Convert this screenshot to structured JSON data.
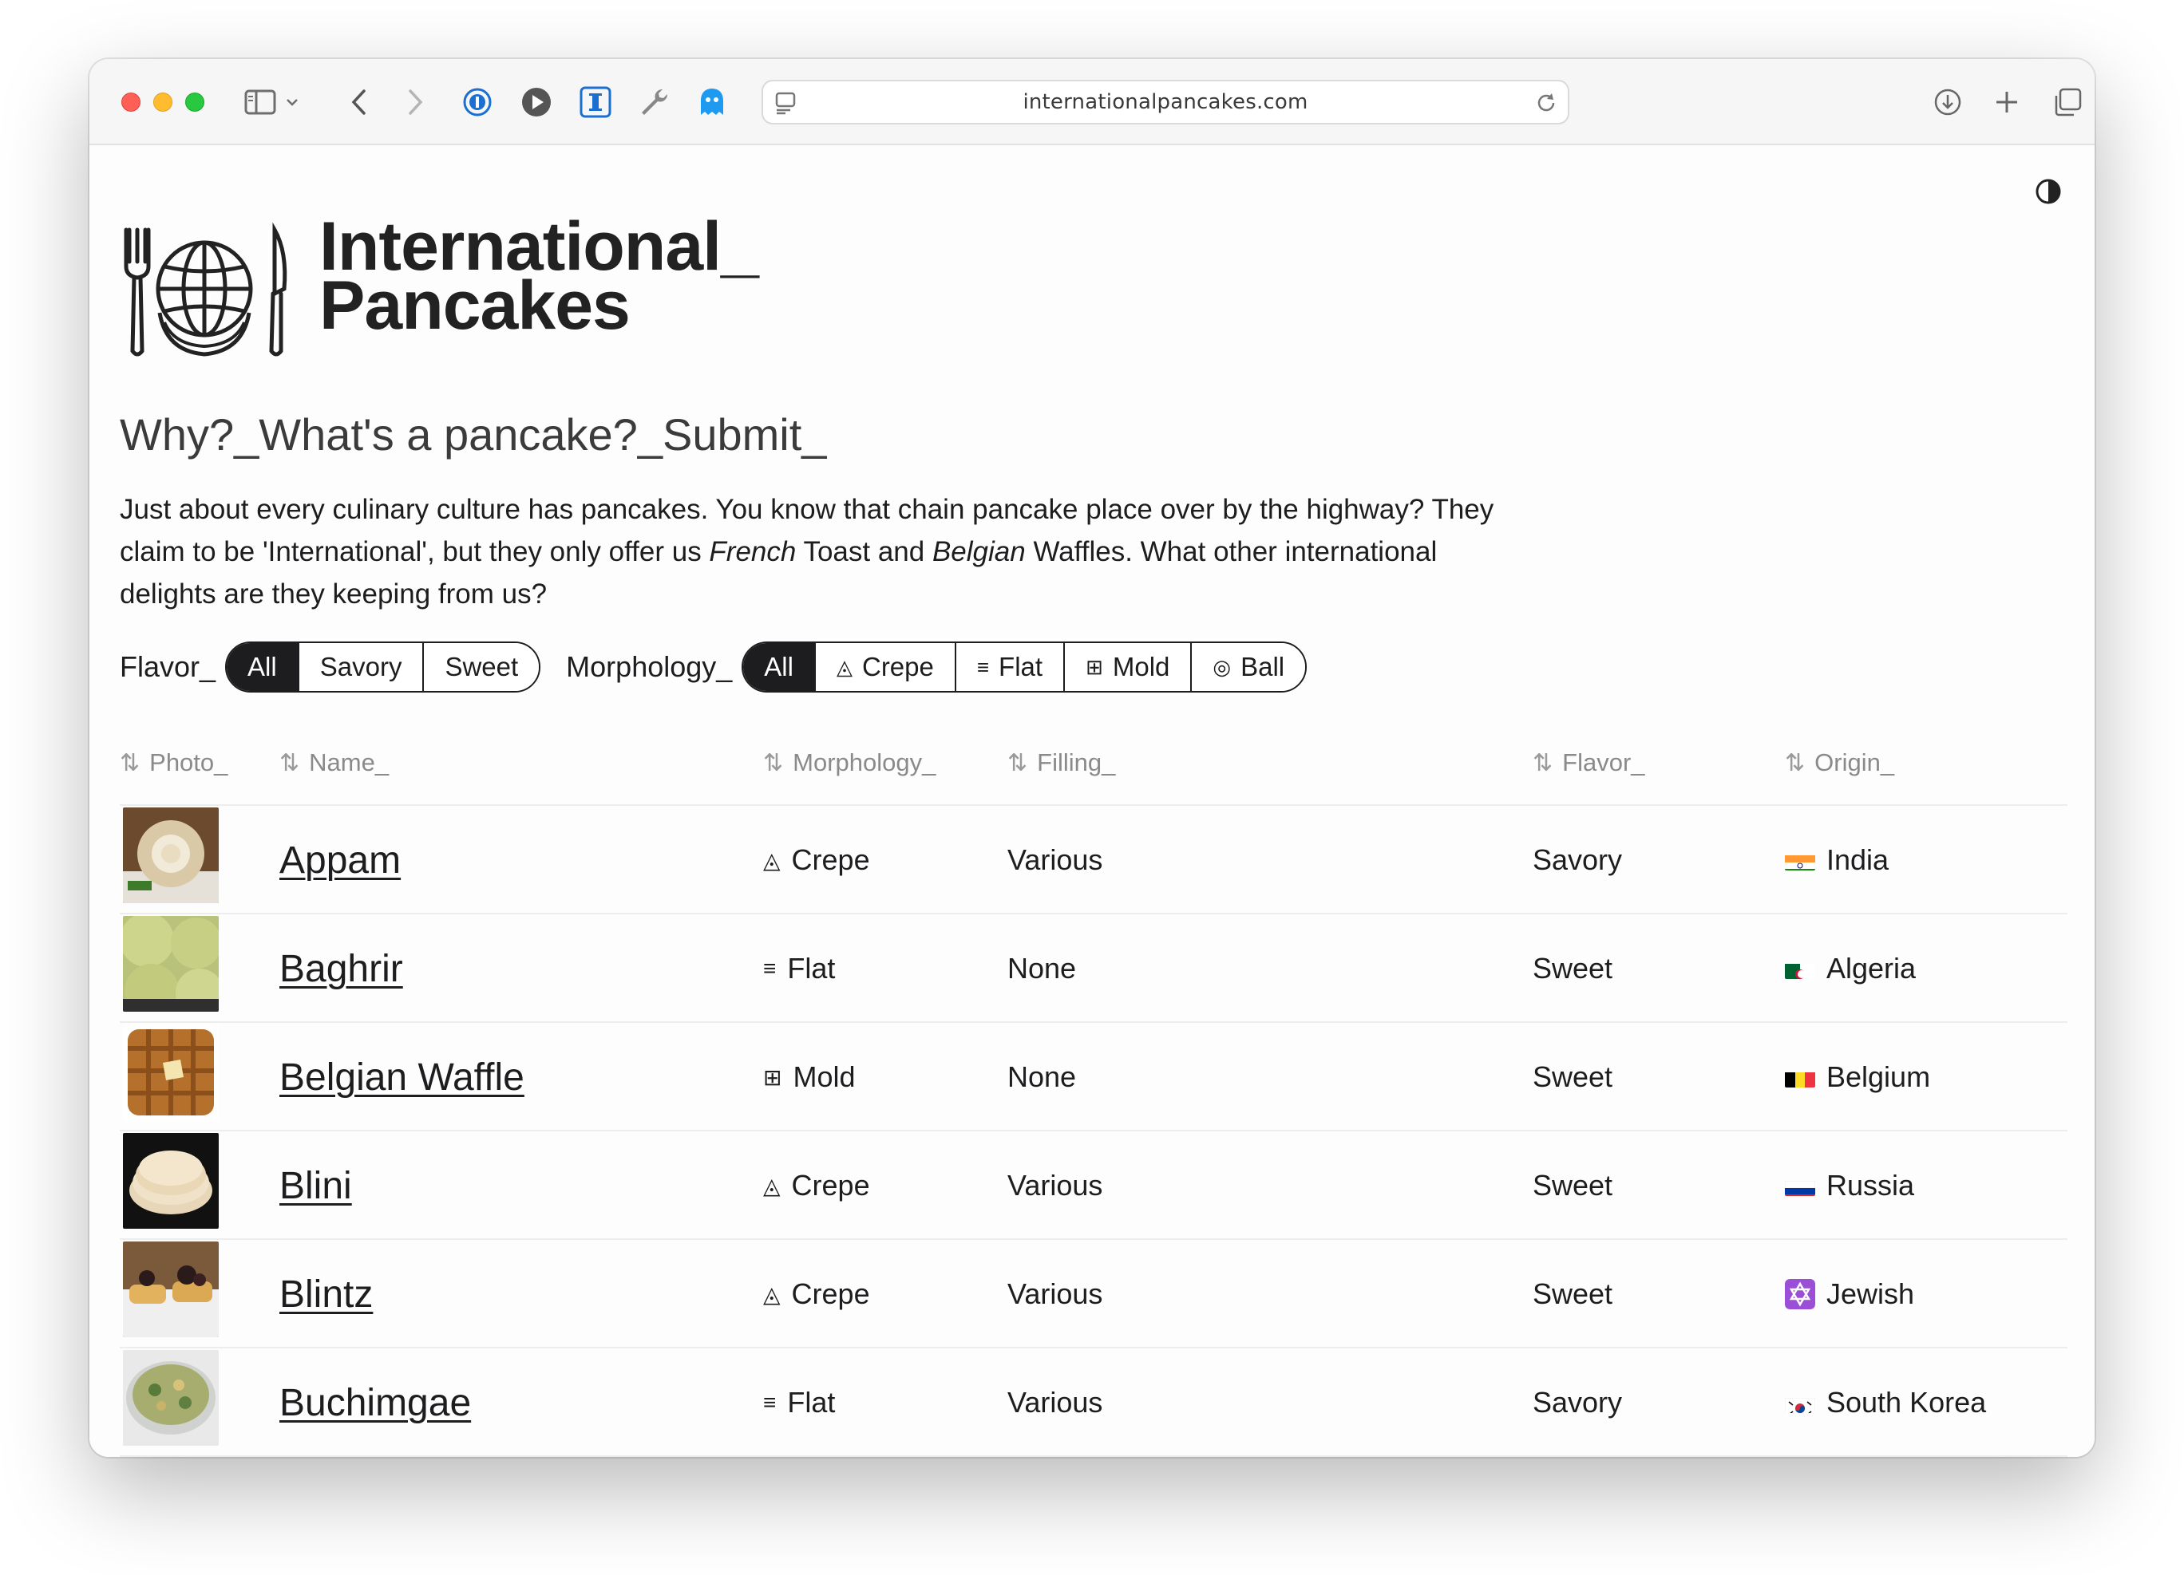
{
  "browser": {
    "url": "internationalpancakes.com",
    "toolbar_icons": [
      "sidebar-icon",
      "chevron-down-icon",
      "back-icon",
      "forward-icon",
      "password-manager-icon",
      "play-icon",
      "instapaper-icon",
      "wrench-icon",
      "ghost-icon",
      "page-settings-icon",
      "reload-icon",
      "download-icon",
      "new-tab-icon",
      "tabs-overview-icon"
    ]
  },
  "site": {
    "brand_line1": "International_",
    "brand_line2": "Pancakes",
    "theme_toggle_icon": "contrast-icon"
  },
  "nav": {
    "why": "Why?_",
    "whats": "What's a pancake?_",
    "submit": "Submit_"
  },
  "intro": {
    "part1": "Just about every culinary culture has pancakes. You know that chain pancake place over by the highway? They claim to be 'International', but they only offer us ",
    "french": "French",
    "part2": " Toast and ",
    "belgian": "Belgian",
    "part3": " Waffles. What other international delights are they keeping from us?"
  },
  "filters": {
    "flavor_label": "Flavor_",
    "flavor_options": [
      "All",
      "Savory",
      "Sweet"
    ],
    "flavor_selected": "All",
    "morph_label": "Morphology_",
    "morph_options": [
      {
        "label": "All",
        "icon": ""
      },
      {
        "label": "Crepe",
        "icon": "◬"
      },
      {
        "label": "Flat",
        "icon": "≡"
      },
      {
        "label": "Mold",
        "icon": "⊞"
      },
      {
        "label": "Ball",
        "icon": "◎"
      }
    ],
    "morph_selected": "All"
  },
  "table": {
    "headers": {
      "photo": "Photo_",
      "name": "Name_",
      "morphology": "Morphology_",
      "filling": "Filling_",
      "flavor": "Flavor_",
      "origin": "Origin_"
    },
    "sort_icon": "⇅",
    "rows": [
      {
        "name": "Appam",
        "morph": "Crepe",
        "morph_icon": "◬",
        "filling": "Various",
        "flavor": "Savory",
        "origin": "India",
        "flag": "india"
      },
      {
        "name": "Baghrir",
        "morph": "Flat",
        "morph_icon": "≡",
        "filling": "None",
        "flavor": "Sweet",
        "origin": "Algeria",
        "flag": "algeria"
      },
      {
        "name": "Belgian Waffle",
        "morph": "Mold",
        "morph_icon": "⊞",
        "filling": "None",
        "flavor": "Sweet",
        "origin": "Belgium",
        "flag": "belgium"
      },
      {
        "name": "Blini",
        "morph": "Crepe",
        "morph_icon": "◬",
        "filling": "Various",
        "flavor": "Sweet",
        "origin": "Russia",
        "flag": "russia"
      },
      {
        "name": "Blintz",
        "morph": "Crepe",
        "morph_icon": "◬",
        "filling": "Various",
        "flavor": "Sweet",
        "origin": "Jewish",
        "flag": "jewish"
      },
      {
        "name": "Buchimgae",
        "morph": "Flat",
        "morph_icon": "≡",
        "filling": "Various",
        "flavor": "Savory",
        "origin": "South Korea",
        "flag": "south-korea"
      }
    ]
  },
  "colors": {
    "text": "#1d1d1f",
    "muted": "#8a8a8a",
    "active_bg": "#1d1d1f",
    "row_border": "#ededed"
  }
}
